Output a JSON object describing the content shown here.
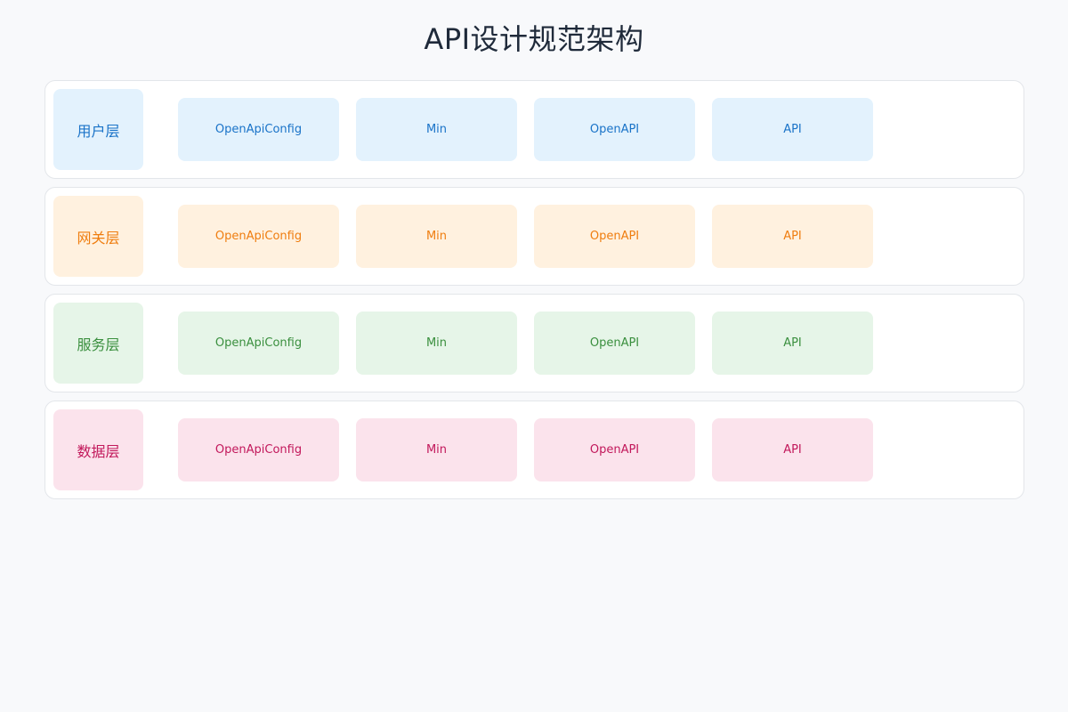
{
  "title": "API设计规范架构",
  "layers": [
    {
      "label": "用户层",
      "bg": "#e3f2fd",
      "color": "#1a73c8",
      "modules": [
        "OpenApiConfig",
        "Min",
        "OpenAPI",
        "API"
      ]
    },
    {
      "label": "网关层",
      "bg": "#fff1df",
      "color": "#ef7d0f",
      "modules": [
        "OpenApiConfig",
        "Min",
        "OpenAPI",
        "API"
      ]
    },
    {
      "label": "服务层",
      "bg": "#e6f5e8",
      "color": "#3a8f3e",
      "modules": [
        "OpenApiConfig",
        "Min",
        "OpenAPI",
        "API"
      ]
    },
    {
      "label": "数据层",
      "bg": "#fbe3ec",
      "color": "#c2185b",
      "modules": [
        "OpenApiConfig",
        "Min",
        "OpenAPI",
        "API"
      ]
    }
  ]
}
